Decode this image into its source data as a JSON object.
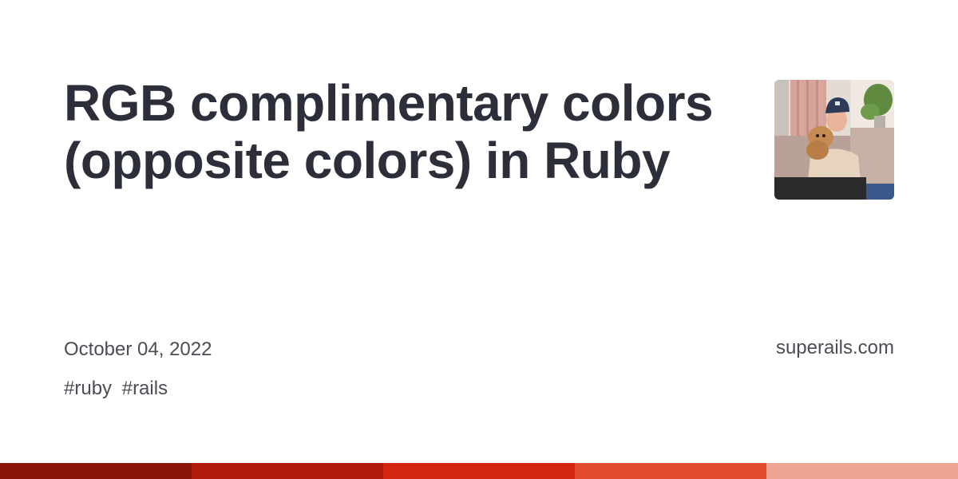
{
  "title": "RGB complimentary colors (opposite colors) in Ruby",
  "date": "October 04, 2022",
  "tags": [
    "#ruby",
    "#rails"
  ],
  "site": "superails.com",
  "avatar": {
    "icon": "author-photo"
  },
  "stripe_colors": [
    "#8a1309",
    "#b01a0a",
    "#d3260f",
    "#e24a2c",
    "#eca493"
  ]
}
